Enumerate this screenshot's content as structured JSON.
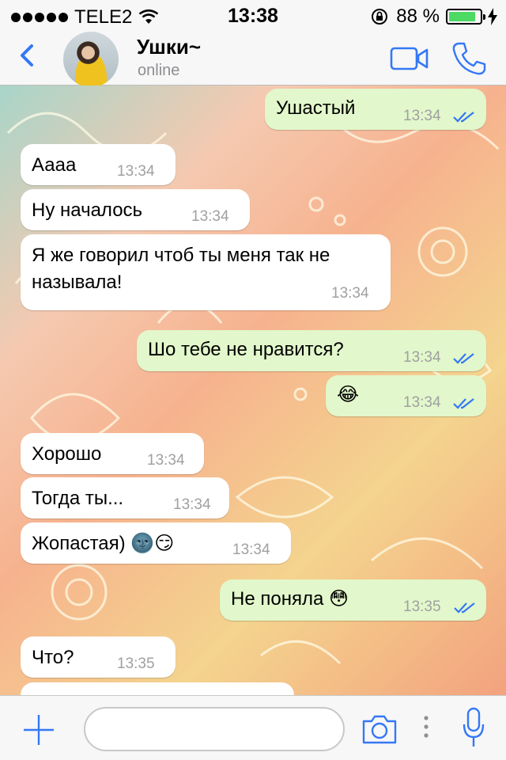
{
  "status_bar": {
    "carrier": "TELE2",
    "time": "13:38",
    "battery_percent": "88 %",
    "battery_level": 0.88
  },
  "header": {
    "contact_name": "Ушки~",
    "contact_status": "online"
  },
  "messages": [
    {
      "dir": "out",
      "text": "Ушастый",
      "time": "13:34",
      "read": true
    },
    {
      "dir": "in",
      "text": "Аааа",
      "time": "13:34"
    },
    {
      "dir": "in",
      "text": "Ну началось",
      "time": "13:34"
    },
    {
      "dir": "in",
      "text": "Я же говорил чтоб ты меня так не называла!",
      "time": "13:34"
    },
    {
      "dir": "out",
      "text": "Шо тебе не нравится?",
      "time": "13:34",
      "read": true
    },
    {
      "dir": "out",
      "text": "😂",
      "time": "13:34",
      "read": true
    },
    {
      "dir": "in",
      "text": "Хорошо",
      "time": "13:34"
    },
    {
      "dir": "in",
      "text": "Тогда ты...",
      "time": "13:34"
    },
    {
      "dir": "in",
      "text": "Жопастая) 🌚😏",
      "time": "13:34"
    },
    {
      "dir": "out",
      "text": "Не поняла 😳",
      "time": "13:35",
      "read": true
    },
    {
      "dir": "in",
      "text": "Что?",
      "time": "13:35"
    }
  ],
  "input": {
    "placeholder": ""
  },
  "colors": {
    "accent": "#3478f6",
    "outgoing_bubble": "#e2f7cb",
    "incoming_bubble": "#ffffff",
    "battery": "#4cd964",
    "read_ticks": "#3478f6"
  },
  "icons": [
    "back-chevron-icon",
    "video-camera-icon",
    "phone-icon",
    "plus-icon",
    "camera-icon",
    "microphone-icon",
    "wifi-icon",
    "rotation-lock-icon",
    "charging-icon",
    "double-check-icon"
  ]
}
